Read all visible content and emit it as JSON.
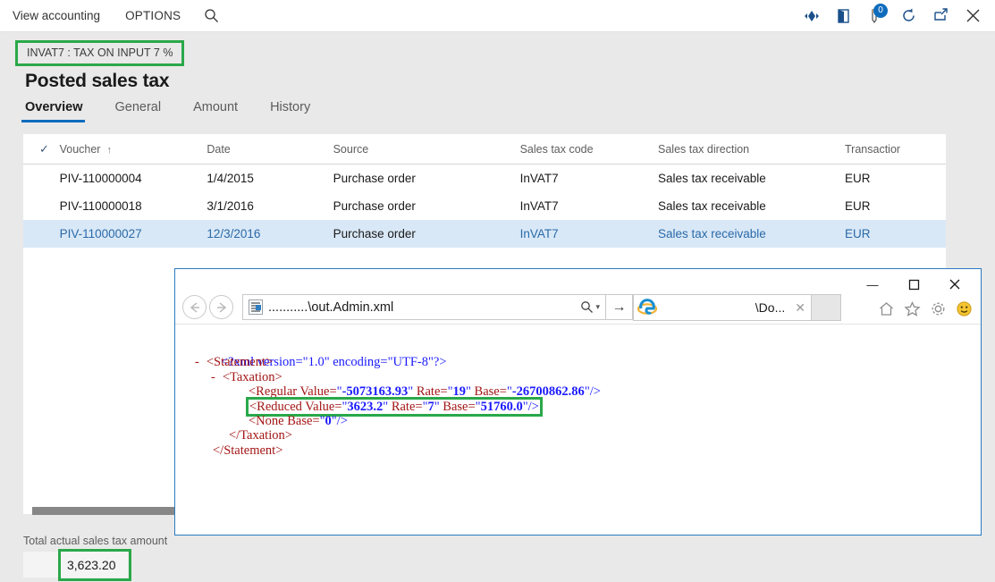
{
  "topbar": {
    "menu": [
      {
        "label": "View accounting",
        "name": "menu-view-accounting"
      },
      {
        "label": "OPTIONS",
        "name": "menu-options"
      }
    ],
    "search_icon": "search-icon",
    "right_icons": [
      {
        "name": "nav-diamond-icon",
        "glyph": "❖"
      },
      {
        "name": "office-book-icon",
        "glyph": "◗"
      },
      {
        "name": "notifications-pen-icon",
        "glyph": "✎",
        "badge": "0"
      },
      {
        "name": "refresh-icon",
        "glyph": "↻"
      },
      {
        "name": "popout-icon",
        "glyph": "↗"
      },
      {
        "name": "close-icon",
        "glyph": "✕"
      }
    ]
  },
  "header": {
    "caption": "INVAT7 : TAX ON INPUT 7 %",
    "title": "Posted sales tax"
  },
  "tabs": [
    {
      "label": "Overview",
      "active": true
    },
    {
      "label": "General",
      "active": false
    },
    {
      "label": "Amount",
      "active": false
    },
    {
      "label": "History",
      "active": false
    }
  ],
  "grid": {
    "columns": {
      "check": "✓",
      "voucher": "Voucher",
      "sort_arrow": "↑",
      "date": "Date",
      "source": "Source",
      "sales_tax_code": "Sales tax code",
      "sales_tax_direction": "Sales tax direction",
      "transaction": "Transactior"
    },
    "rows": [
      {
        "voucher": "PIV-110000004",
        "date": "1/4/2015",
        "source": "Purchase order",
        "code": "InVAT7",
        "direction": "Sales tax receivable",
        "currency": "EUR",
        "selected": false
      },
      {
        "voucher": "PIV-110000018",
        "date": "3/1/2016",
        "source": "Purchase order",
        "code": "InVAT7",
        "direction": "Sales tax receivable",
        "currency": "EUR",
        "selected": false
      },
      {
        "voucher": "PIV-110000027",
        "date": "12/3/2016",
        "source": "Purchase order",
        "code": "InVAT7",
        "direction": "Sales tax receivable",
        "currency": "EUR",
        "selected": true
      }
    ]
  },
  "footer": {
    "total_label": "Total actual sales tax amount",
    "total_value": "3,623.20"
  },
  "browser": {
    "back_glyph": "←",
    "forward_glyph": "→",
    "address": "...........\\out.Admin.xml",
    "search_glyph": "⌕",
    "dropdown_glyph": "▾",
    "go_glyph": "→",
    "tab_title": "\\Do...",
    "tab_close": "✕",
    "window_controls": {
      "minimize": "—",
      "maximize": "☐",
      "close": "✕"
    },
    "tools": [
      {
        "name": "home-icon",
        "glyph": "⌂"
      },
      {
        "name": "favorites-star-icon",
        "glyph": "☆"
      },
      {
        "name": "settings-gear-icon",
        "glyph": "⚙"
      },
      {
        "name": "feedback-smiley-icon",
        "glyph": "☺"
      }
    ]
  },
  "xml": {
    "declaration": "<?xml version=\"1.0\" encoding=\"UTF-8\"?>",
    "lines": [
      {
        "indent": 1,
        "collapse": "",
        "text": "<?xml version=\"1.0\" encoding=\"UTF-8\"?>",
        "kind": "decl"
      },
      {
        "indent": 0,
        "collapse": "-",
        "text": "<Statement>",
        "kind": "tag"
      },
      {
        "indent": 1,
        "collapse": "-",
        "text": "<Taxation>",
        "kind": "tag"
      },
      {
        "indent": 3,
        "collapse": "",
        "text": "<Regular Value=\"-5073163.93\" Rate=\"19\" Base=\"-26700862.86\"/>",
        "kind": "element"
      },
      {
        "indent": 3,
        "collapse": "",
        "text": "<Reduced Value=\"3623.2\" Rate=\"7\" Base=\"51760.0\"/>",
        "kind": "element",
        "highlight": true
      },
      {
        "indent": 3,
        "collapse": "",
        "text": "<None Base=\"0\"/>",
        "kind": "element"
      },
      {
        "indent": 2,
        "collapse": "",
        "text": "</Taxation>",
        "kind": "tag"
      },
      {
        "indent": 1,
        "collapse": "",
        "text": "</Statement>",
        "kind": "tag"
      }
    ],
    "elements": {
      "regular": {
        "tag": "Regular",
        "Value": "-5073163.93",
        "Rate": "19",
        "Base": "-26700862.86"
      },
      "reduced": {
        "tag": "Reduced",
        "Value": "3623.2",
        "Rate": "7",
        "Base": "51760.0"
      },
      "none": {
        "tag": "None",
        "Base": "0"
      }
    }
  },
  "colors": {
    "accent": "#0f6cbd",
    "highlight_green": "#2aa84a",
    "selected_row": "#d9e8f7",
    "xml_tag": "#a31515",
    "xml_value": "#1a1aff"
  }
}
